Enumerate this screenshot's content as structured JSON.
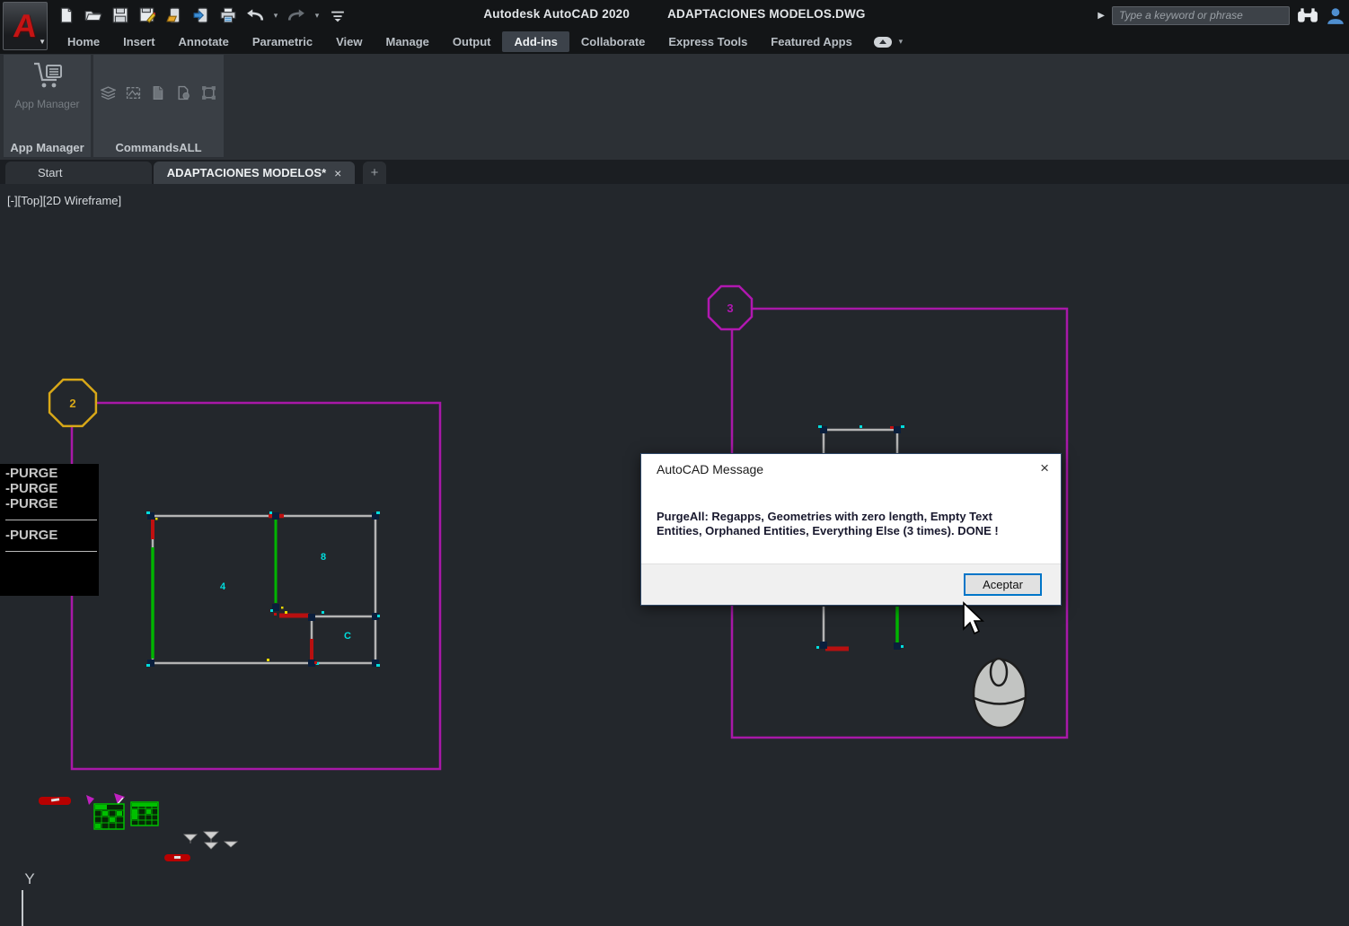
{
  "titlebar": {
    "app_title": "Autodesk AutoCAD 2020",
    "doc_title": "ADAPTACIONES MODELOS.DWG",
    "search_placeholder": "Type a keyword or phrase",
    "logo_letter": "A",
    "qat_icons": [
      "new-file",
      "open-file",
      "save",
      "save-as",
      "open-from-mobile",
      "save-to-mobile",
      "plot",
      "undo",
      "redo",
      "customize-quick-access"
    ]
  },
  "ribbon": {
    "tabs": [
      {
        "label": "Home"
      },
      {
        "label": "Insert"
      },
      {
        "label": "Annotate"
      },
      {
        "label": "Parametric"
      },
      {
        "label": "View"
      },
      {
        "label": "Manage"
      },
      {
        "label": "Output"
      },
      {
        "label": "Add-ins"
      },
      {
        "label": "Collaborate"
      },
      {
        "label": "Express Tools"
      },
      {
        "label": "Featured Apps"
      }
    ],
    "active_tab": "Add-ins",
    "panels": {
      "app_manager": {
        "button_label": "App Manager",
        "panel_label": "App Manager"
      },
      "commands_all": {
        "panel_label": "CommandsALL",
        "icons": [
          "layer-stack",
          "image-frame",
          "file-copy",
          "file-gear",
          "boundary"
        ]
      }
    }
  },
  "file_tabs": {
    "start": "Start",
    "active_doc": "ADAPTACIONES MODELOS*",
    "close_glyph": "×",
    "new_tab_glyph": "+"
  },
  "viewport": {
    "controls": "[-][Top][2D Wireframe]",
    "ucs_axis": "Y"
  },
  "command_history": {
    "lines": [
      "-PURGE",
      "-PURGE",
      "-PURGE",
      "-PURGE"
    ]
  },
  "drawing": {
    "zone2_label": "2",
    "zone3_label": "3",
    "room_a_label": "4",
    "room_b_label": "8",
    "room_c_label": "C"
  },
  "dialog": {
    "title": "AutoCAD Message",
    "close_glyph": "×",
    "message": "PurgeAll: Regapps, Geometries with zero length, Empty Text Entities, Orphaned Entities, Everything Else (3 times). DONE !",
    "ok_label": "Aceptar"
  },
  "colors": {
    "magenta": "#b018b0",
    "green": "#00b400",
    "red": "#b81010",
    "cyan": "#00dcdc",
    "gold": "#d8a818",
    "dialog_accent": "#0075c8",
    "canvas_bg": "#23272c"
  }
}
